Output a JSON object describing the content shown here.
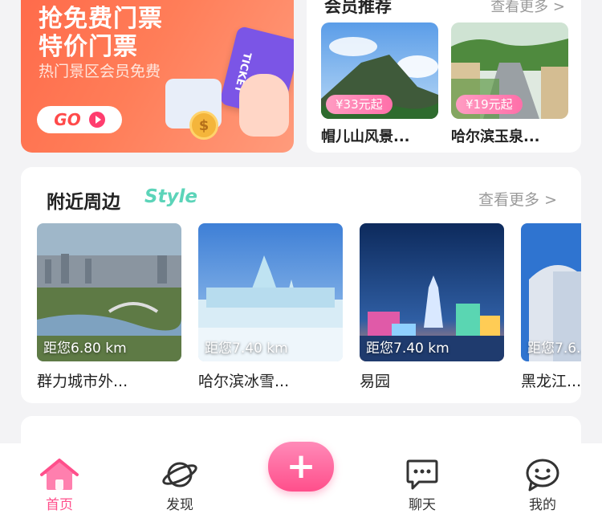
{
  "promo": {
    "line1": "抢免费门票",
    "line2": "特价门票",
    "subtitle": "热门景区会员免费",
    "go_label": "GO",
    "ticket_label": "TICKET",
    "coin_symbol": "$"
  },
  "member": {
    "title": "会员推荐",
    "more": "查看更多 >",
    "items": [
      {
        "name": "帽儿山风景...",
        "price": "¥33元起"
      },
      {
        "name": "哈尔滨玉泉...",
        "price": "¥19元起"
      }
    ]
  },
  "nearby": {
    "title": "附近周边",
    "title_style": "Style",
    "more": "查看更多 >",
    "items": [
      {
        "name": "群力城市外...",
        "distance": "距您6.80 km"
      },
      {
        "name": "哈尔滨冰雪...",
        "distance": "距您7.40 km"
      },
      {
        "name": "易园",
        "distance": "距您7.40 km"
      },
      {
        "name": "黑龙江...",
        "distance": "距您7.6..."
      }
    ]
  },
  "tabbar": {
    "items": [
      {
        "label": "首页",
        "icon": "home-icon",
        "active": true
      },
      {
        "label": "发现",
        "icon": "planet-icon",
        "active": false
      },
      {
        "label": "",
        "icon": "plus-icon",
        "active": false
      },
      {
        "label": "聊天",
        "icon": "chat-icon",
        "active": false
      },
      {
        "label": "我的",
        "icon": "smile-icon",
        "active": false
      }
    ]
  },
  "colors": {
    "accent": "#ff4f8b",
    "promo_bg": "#ff6a4a",
    "style_text": "#5cd4b9"
  }
}
